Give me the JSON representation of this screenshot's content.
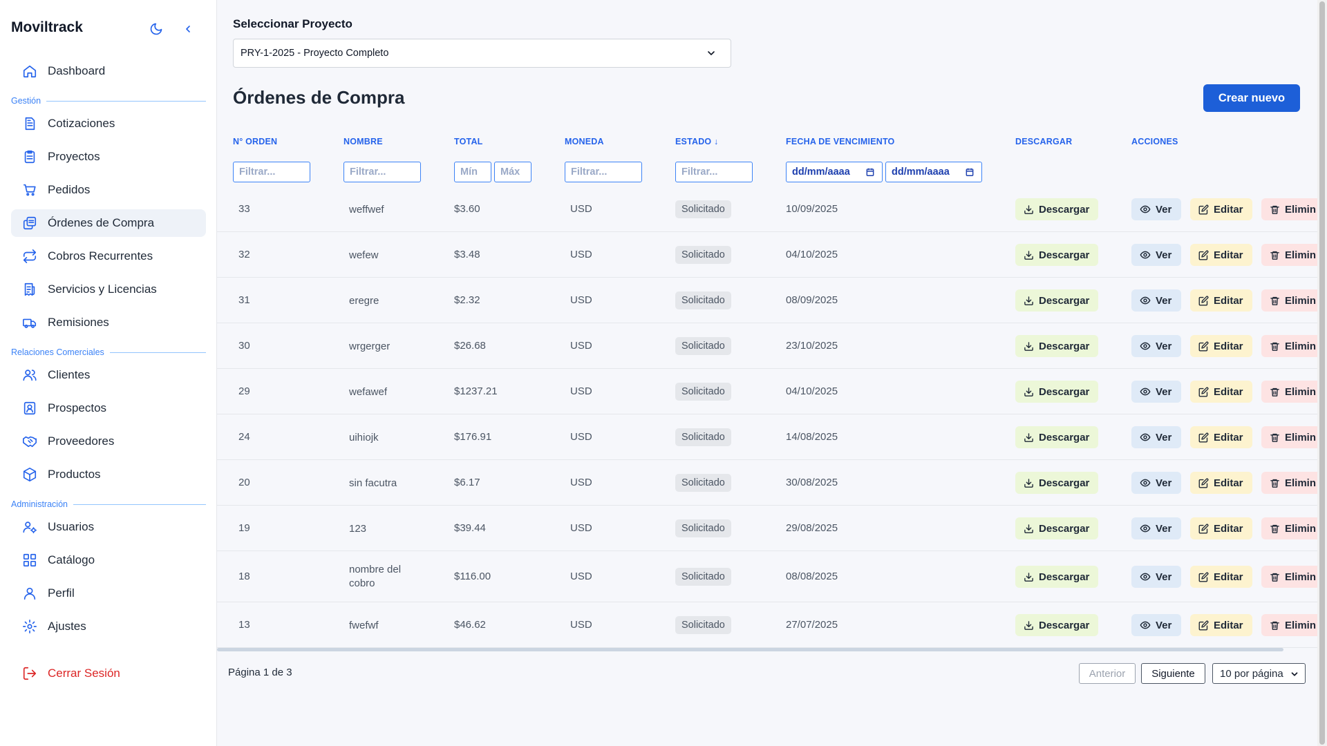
{
  "sidebar": {
    "brand": "Moviltrack",
    "items": [
      {
        "label": "Dashboard",
        "icon": "home-icon"
      },
      {
        "label": "Cotizaciones",
        "icon": "document-icon"
      },
      {
        "label": "Proyectos",
        "icon": "clipboard-icon"
      },
      {
        "label": "Pedidos",
        "icon": "cart-icon"
      },
      {
        "label": "Órdenes de Compra",
        "icon": "copy-icon"
      },
      {
        "label": "Cobros Recurrentes",
        "icon": "repeat-icon"
      },
      {
        "label": "Servicios y Licencias",
        "icon": "receipt-icon"
      },
      {
        "label": "Remisiones",
        "icon": "truck-icon"
      },
      {
        "label": "Clientes",
        "icon": "users-icon"
      },
      {
        "label": "Prospectos",
        "icon": "contact-icon"
      },
      {
        "label": "Proveedores",
        "icon": "handshake-icon"
      },
      {
        "label": "Productos",
        "icon": "box-icon"
      },
      {
        "label": "Usuarios",
        "icon": "user-cog-icon"
      },
      {
        "label": "Catálogo",
        "icon": "grid-icon"
      },
      {
        "label": "Perfil",
        "icon": "user-icon"
      },
      {
        "label": "Ajustes",
        "icon": "gear-icon"
      }
    ],
    "sections": [
      "Gestión",
      "Relaciones Comerciales",
      "Administración"
    ],
    "logout": "Cerrar Sesión",
    "active_item": "Órdenes de Compra"
  },
  "project": {
    "label": "Seleccionar Proyecto",
    "selected": "PRY-1-2025 - Proyecto Completo"
  },
  "page": {
    "title": "Órdenes de Compra",
    "create_button": "Crear nuevo"
  },
  "table": {
    "headers": {
      "orden": "N° ORDEN",
      "nombre": "NOMBRE",
      "total": "TOTAL",
      "moneda": "MONEDA",
      "estado": "ESTADO ↓",
      "fecha": "FECHA DE VENCIMIENTO",
      "descargar": "DESCARGAR",
      "acciones": "ACCIONES"
    },
    "filters": {
      "placeholder": "Filtrar...",
      "min_placeholder": "Mín",
      "max_placeholder": "Máx",
      "date_from": "dd/mm/aaaa",
      "date_to": "dd/mm/aaaa"
    },
    "buttons": {
      "download": "Descargar",
      "view": "Ver",
      "edit": "Editar",
      "delete": "Elimin"
    },
    "rows": [
      {
        "orden": "33",
        "nombre": "weffwef",
        "total": "$3.60",
        "moneda": "USD",
        "estado": "Solicitado",
        "fecha": "10/09/2025"
      },
      {
        "orden": "32",
        "nombre": "wefew",
        "total": "$3.48",
        "moneda": "USD",
        "estado": "Solicitado",
        "fecha": "04/10/2025"
      },
      {
        "orden": "31",
        "nombre": "eregre",
        "total": "$2.32",
        "moneda": "USD",
        "estado": "Solicitado",
        "fecha": "08/09/2025"
      },
      {
        "orden": "30",
        "nombre": "wrgerger",
        "total": "$26.68",
        "moneda": "USD",
        "estado": "Solicitado",
        "fecha": "23/10/2025"
      },
      {
        "orden": "29",
        "nombre": "wefawef",
        "total": "$1237.21",
        "moneda": "USD",
        "estado": "Solicitado",
        "fecha": "04/10/2025"
      },
      {
        "orden": "24",
        "nombre": "uihiojk",
        "total": "$176.91",
        "moneda": "USD",
        "estado": "Solicitado",
        "fecha": "14/08/2025"
      },
      {
        "orden": "20",
        "nombre": "sin facutra",
        "total": "$6.17",
        "moneda": "USD",
        "estado": "Solicitado",
        "fecha": "30/08/2025"
      },
      {
        "orden": "19",
        "nombre": "123",
        "total": "$39.44",
        "moneda": "USD",
        "estado": "Solicitado",
        "fecha": "29/08/2025"
      },
      {
        "orden": "18",
        "nombre": "nombre del cobro",
        "total": "$116.00",
        "moneda": "USD",
        "estado": "Solicitado",
        "fecha": "08/08/2025"
      },
      {
        "orden": "13",
        "nombre": "fwefwf",
        "total": "$46.62",
        "moneda": "USD",
        "estado": "Solicitado",
        "fecha": "27/07/2025"
      }
    ]
  },
  "pagination": {
    "info": "Página 1 de 3",
    "prev": "Anterior",
    "next": "Siguiente",
    "per_page": "10 por página"
  },
  "colors": {
    "accent": "#1d5fd8",
    "header_text": "#2563eb",
    "logout": "#dc2626"
  }
}
